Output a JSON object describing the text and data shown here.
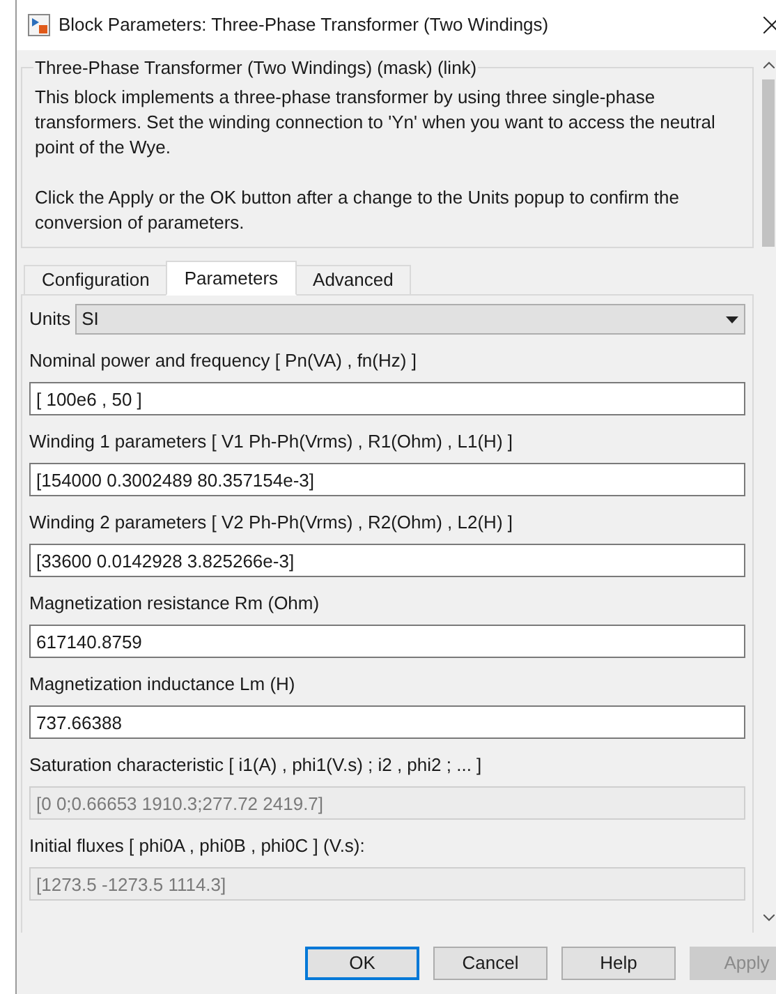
{
  "window": {
    "title": "Block Parameters: Three-Phase Transformer (Two Windings)"
  },
  "group": {
    "title": "Three-Phase Transformer (Two Windings) (mask) (link)",
    "paragraphs": [
      "This block implements a three-phase transformer by using three single-phase transformers. Set the winding connection to 'Yn'  when you want to access the neutral point of the Wye.",
      "Click the Apply or the OK button after a change to the Units popup to confirm the conversion of parameters."
    ]
  },
  "tabs": [
    {
      "label": "Configuration",
      "selected": false
    },
    {
      "label": "Parameters",
      "selected": true
    },
    {
      "label": "Advanced",
      "selected": false
    }
  ],
  "units": {
    "label": "Units",
    "value": "SI"
  },
  "fields": [
    {
      "label": "Nominal power and frequency  [ Pn(VA) , fn(Hz) ]",
      "value": "[ 100e6 , 50 ]",
      "disabled": false
    },
    {
      "label": "Winding 1 parameters [ V1 Ph-Ph(Vrms) , R1(Ohm) , L1(H) ]",
      "value": "[154000 0.3002489 80.357154e-3]",
      "disabled": false
    },
    {
      "label": "Winding 2 parameters [ V2 Ph-Ph(Vrms) , R2(Ohm) , L2(H) ]",
      "value": "[33600 0.0142928 3.825266e-3]",
      "disabled": false
    },
    {
      "label": "Magnetization resistance  Rm (Ohm)",
      "value": "617140.8759",
      "disabled": false
    },
    {
      "label": "Magnetization inductance  Lm (H)",
      "value": "737.66388",
      "disabled": false
    },
    {
      "label": "Saturation characteristic [ i1(A) ,  phi1(V.s) ;  i2 , phi2 ; ... ]",
      "value": "[0 0;0.66653 1910.3;277.72 2419.7]",
      "disabled": true
    },
    {
      "label": "Initial fluxes [ phi0A , phi0B , phi0C ] (V.s):",
      "value": "[1273.5 -1273.5 1114.3]",
      "disabled": true
    }
  ],
  "buttons": [
    {
      "label": "OK",
      "default": true,
      "disabled": false
    },
    {
      "label": "Cancel",
      "default": false,
      "disabled": false
    },
    {
      "label": "Help",
      "default": false,
      "disabled": false
    },
    {
      "label": "Apply",
      "default": false,
      "disabled": true
    }
  ]
}
